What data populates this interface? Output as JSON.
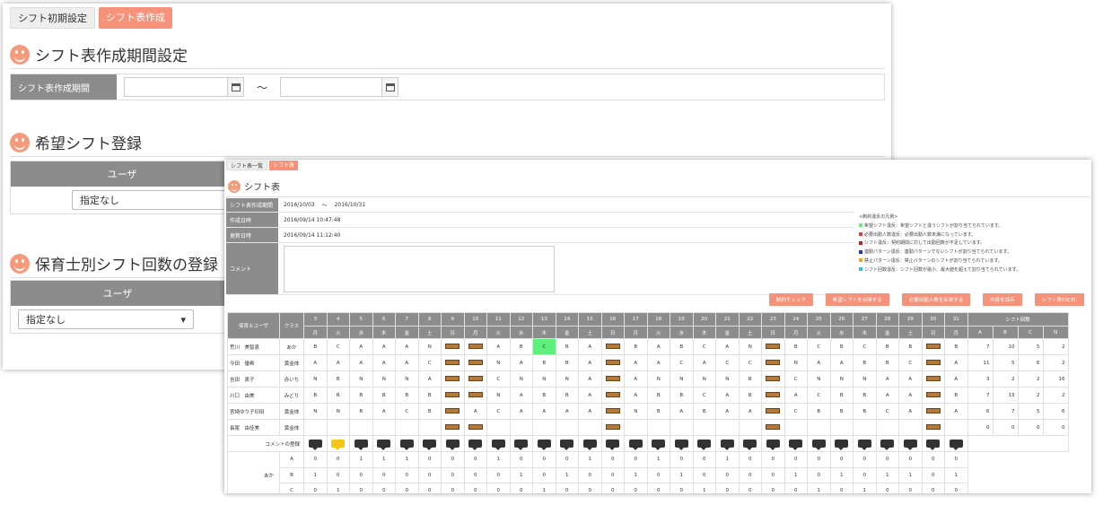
{
  "back": {
    "tabs": [
      {
        "label": "シフト初期設定",
        "active": false
      },
      {
        "label": "シフト表作成",
        "active": true
      }
    ],
    "period_section": {
      "title": "シフト表作成期間設定",
      "label": "シフト表作成期間",
      "start_value": "",
      "end_value": "",
      "separator": "～"
    },
    "wish_section": {
      "title": "希望シフト登録",
      "user_header": "ユーザ",
      "user_select": "指定なし"
    },
    "count_section": {
      "title": "保育士別シフト回数の登録",
      "user_header": "ユーザ",
      "user_select": "指定なし"
    }
  },
  "front": {
    "tabs": [
      {
        "label": "シフト表一覧",
        "active": false
      },
      {
        "label": "シフト表",
        "active": true
      }
    ],
    "title": "シフト表",
    "info": {
      "period_label": "シフト表作成期間",
      "period_start": "2016/10/03",
      "period_sep": "～",
      "period_end": "2016/10/31",
      "created_label": "作成日時",
      "created_value": "2016/09/14 10:47:48",
      "updated_label": "更新日時",
      "updated_value": "2016/09/14 11:12:40",
      "comment_label": "コメント"
    },
    "legend": {
      "title": "<制約違反の凡例>",
      "items": [
        {
          "color": "#5ef07a",
          "text": "希望シフト違反：希望シフトと違うシフトが割り当てられています。"
        },
        {
          "color": "#e83a3a",
          "text": "必要出勤人数違反：必要出勤人数未満になっています。"
        },
        {
          "color": "#cc1f1f",
          "text": "シフト違反：契約期間に対して出勤回数が不足しています。"
        },
        {
          "color": "#2233cc",
          "text": "連勤パターン違反：連勤パターンでないシフトが割り当てられています。"
        },
        {
          "color": "#f5a020",
          "text": "禁止パターン違反：禁止パターンのシフトが割り当てられています。"
        },
        {
          "color": "#38bcd6",
          "text": "シフト回数違反：シフト回数が最小、最大値を超えて割り当てられています。"
        }
      ]
    },
    "buttons": [
      "制約チェック",
      "希望シフトを反映する",
      "必要出勤人数を反映する",
      "内容を保存",
      "シフト表EXCEL"
    ],
    "grid": {
      "user_header": "保育士ユーザ",
      "class_header": "クラス",
      "days": [
        "3",
        "4",
        "5",
        "6",
        "7",
        "8",
        "9",
        "10",
        "11",
        "12",
        "13",
        "14",
        "15",
        "16",
        "17",
        "18",
        "19",
        "20",
        "21",
        "22",
        "23",
        "24",
        "25",
        "26",
        "27",
        "28",
        "29",
        "30",
        "31"
      ],
      "weekdays": [
        "月",
        "火",
        "水",
        "木",
        "金",
        "土",
        "日",
        "月",
        "火",
        "水",
        "木",
        "金",
        "土",
        "日",
        "月",
        "火",
        "水",
        "木",
        "金",
        "土",
        "日",
        "月",
        "火",
        "水",
        "木",
        "金",
        "土",
        "日",
        "月"
      ],
      "summary_header": "シフト回数",
      "summary_cols": [
        "A",
        "B",
        "C",
        "N"
      ],
      "rows": [
        {
          "name": "荒川　美智恵",
          "cls": "あか",
          "cells": [
            "B",
            "C",
            "A",
            "A",
            "A",
            "N",
            "P",
            "P",
            "A",
            "B",
            "C",
            "B",
            "A",
            "P",
            "B",
            "A",
            "B",
            "C",
            "A",
            "N",
            "P",
            "B",
            "C",
            "B",
            "C",
            "B",
            "B",
            "P",
            "B"
          ],
          "sums": [
            "7",
            "10",
            "5",
            "2"
          ],
          "highlight": 10
        },
        {
          "name": "今田　優希",
          "cls": "黄金体",
          "cells": [
            "A",
            "A",
            "A",
            "A",
            "A",
            "C",
            "P",
            "P",
            "N",
            "A",
            "B",
            "B",
            "A",
            "P",
            "A",
            "A",
            "C",
            "A",
            "C",
            "C",
            "P",
            "N",
            "A",
            "A",
            "B",
            "B",
            "C",
            "P",
            "A"
          ],
          "sums": [
            "11",
            "5",
            "6",
            "2"
          ],
          "highlight": -1
        },
        {
          "name": "吉田　恵子",
          "cls": "赤いち",
          "cells": [
            "N",
            "B",
            "N",
            "N",
            "N",
            "A",
            "P",
            "P",
            "C",
            "N",
            "N",
            "N",
            "A",
            "P",
            "A",
            "N",
            "N",
            "N",
            "N",
            "B",
            "P",
            "C",
            "N",
            "N",
            "N",
            "A",
            "A",
            "P",
            "A"
          ],
          "sums": [
            "3",
            "2",
            "2",
            "16"
          ],
          "highlight": -1
        },
        {
          "name": "川口　由美",
          "cls": "みどり",
          "cells": [
            "B",
            "B",
            "B",
            "B",
            "B",
            "B",
            "P",
            "P",
            "N",
            "A",
            "B",
            "B",
            "A",
            "P",
            "A",
            "B",
            "B",
            "C",
            "A",
            "B",
            "P",
            "A",
            "C",
            "B",
            "B",
            "A",
            "A",
            "P",
            "B"
          ],
          "sums": [
            "7",
            "13",
            "2",
            "2"
          ],
          "highlight": -1
        },
        {
          "name": "宮崎ゆり子印田",
          "cls": "黄金体",
          "cells": [
            "N",
            "N",
            "B",
            "A",
            "C",
            "B",
            "P",
            "A",
            "C",
            "A",
            "A",
            "A",
            "A",
            "P",
            "N",
            "B",
            "A",
            "B",
            "A",
            "A",
            "P",
            "C",
            "B",
            "B",
            "B",
            "C",
            "A",
            "P",
            "A"
          ],
          "sums": [
            "6",
            "7",
            "5",
            "6"
          ],
          "highlight": -1
        },
        {
          "name": "長尾　由佳美",
          "cls": "黄金体",
          "cells": [
            "",
            "",
            "",
            "",
            "",
            "",
            "P",
            "P",
            "",
            "",
            "",
            "",
            "",
            "P",
            "",
            "",
            "",
            "",
            "",
            "",
            "P",
            "",
            "",
            "",
            "",
            "",
            "",
            "P",
            ""
          ],
          "sums": [
            "0",
            "0",
            "0",
            "0"
          ],
          "highlight": -1
        }
      ],
      "comment_row_label": "コメントの登録",
      "comment_yellow_index": 1,
      "count_group": "あか",
      "counts": [
        {
          "label": "A",
          "values": [
            "0",
            "0",
            "1",
            "1",
            "1",
            "0",
            "0",
            "0",
            "1",
            "0",
            "0",
            "0",
            "1",
            "0",
            "0",
            "1",
            "0",
            "0",
            "1",
            "0",
            "0",
            "0",
            "0",
            "0",
            "0",
            "0",
            "0",
            "0",
            "0"
          ]
        },
        {
          "label": "B",
          "values": [
            "1",
            "0",
            "0",
            "0",
            "0",
            "0",
            "0",
            "0",
            "0",
            "1",
            "0",
            "1",
            "0",
            "0",
            "1",
            "0",
            "1",
            "0",
            "0",
            "0",
            "0",
            "1",
            "0",
            "1",
            "0",
            "1",
            "1",
            "0",
            "1"
          ]
        },
        {
          "label": "C",
          "values": [
            "0",
            "1",
            "0",
            "0",
            "0",
            "0",
            "0",
            "0",
            "0",
            "0",
            "1",
            "0",
            "0",
            "0",
            "0",
            "0",
            "0",
            "1",
            "0",
            "0",
            "0",
            "0",
            "1",
            "0",
            "1",
            "0",
            "0",
            "0",
            "0"
          ]
        }
      ]
    }
  },
  "colors": {
    "accent": "#f6917a",
    "header_gray": "#8c8c8c",
    "wish_violation": "#5ef07a",
    "comment_highlight": "#f5c518"
  }
}
